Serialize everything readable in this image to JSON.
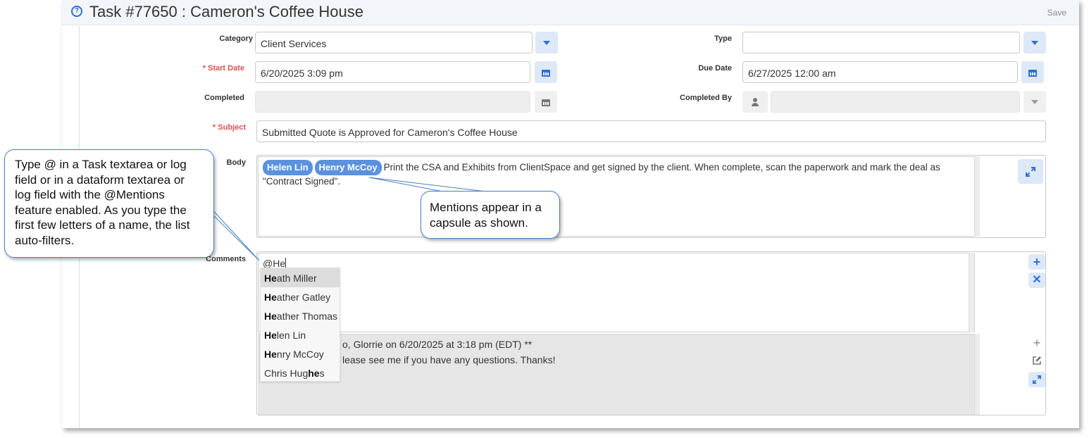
{
  "header": {
    "help_icon": "?",
    "title": "Task #77650 : Cameron's Coffee House",
    "save_label": "Save"
  },
  "form": {
    "category": {
      "label": "Category",
      "value": "Client Services"
    },
    "type": {
      "label": "Type",
      "value": ""
    },
    "start_date": {
      "required_mark": "* ",
      "label": "Start Date",
      "value": "6/20/2025 3:09 pm"
    },
    "due_date": {
      "label": "Due Date",
      "value": "6/27/2025 12:00 am"
    },
    "completed": {
      "label": "Completed",
      "value": ""
    },
    "completed_by": {
      "label": "Completed By",
      "value": ""
    },
    "subject": {
      "required_mark": "* ",
      "label": "Subject",
      "value": "Submitted Quote is Approved for Cameron's Coffee House"
    },
    "body": {
      "label": "Body",
      "mentions": [
        "Helen Lin",
        "Henry McCoy"
      ],
      "text": "Print the CSA and Exhibits from ClientSpace and get signed by the client.  When complete, scan the paperwork and mark the deal as \"Contract Signed\"."
    },
    "comments": {
      "label": "Comments",
      "typed_text": "@He",
      "log_line1_visible": "o, Glorrie on 6/20/2025 at 3:18 pm (EDT) **",
      "log_line2_visible": "lease see me if you have any questions. Thanks!"
    }
  },
  "mention_dropdown": {
    "options": [
      {
        "bold": "He",
        "rest": "ath Miller",
        "active": true
      },
      {
        "bold": "He",
        "rest": "ather Gatley"
      },
      {
        "bold": "He",
        "rest": "ather Thomas"
      },
      {
        "bold": "He",
        "rest": "len Lin"
      },
      {
        "bold": "He",
        "rest": "nry McCoy"
      },
      {
        "prefix": "Chris Hug",
        "bold": "he",
        "rest": "s"
      }
    ]
  },
  "callouts": {
    "left": "Type @ in a Task textarea or log field or in a dataform textarea or log field with the @Mentions feature enabled. As you type the first few letters of a name, the list auto-filters.",
    "right": "Mentions appear in a capsule as shown."
  },
  "icons": {
    "help": "question-circle-icon",
    "dropdown": "caret-down-icon",
    "calendar": "calendar-icon",
    "user": "user-icon",
    "expand": "expand-icon",
    "add": "plus-icon",
    "remove": "times-icon",
    "edit": "edit-icon"
  },
  "colors": {
    "accent": "#2f6fd6",
    "required": "#d9534f",
    "capsule": "#5b91e0",
    "callout_border": "#4a7fc1"
  }
}
